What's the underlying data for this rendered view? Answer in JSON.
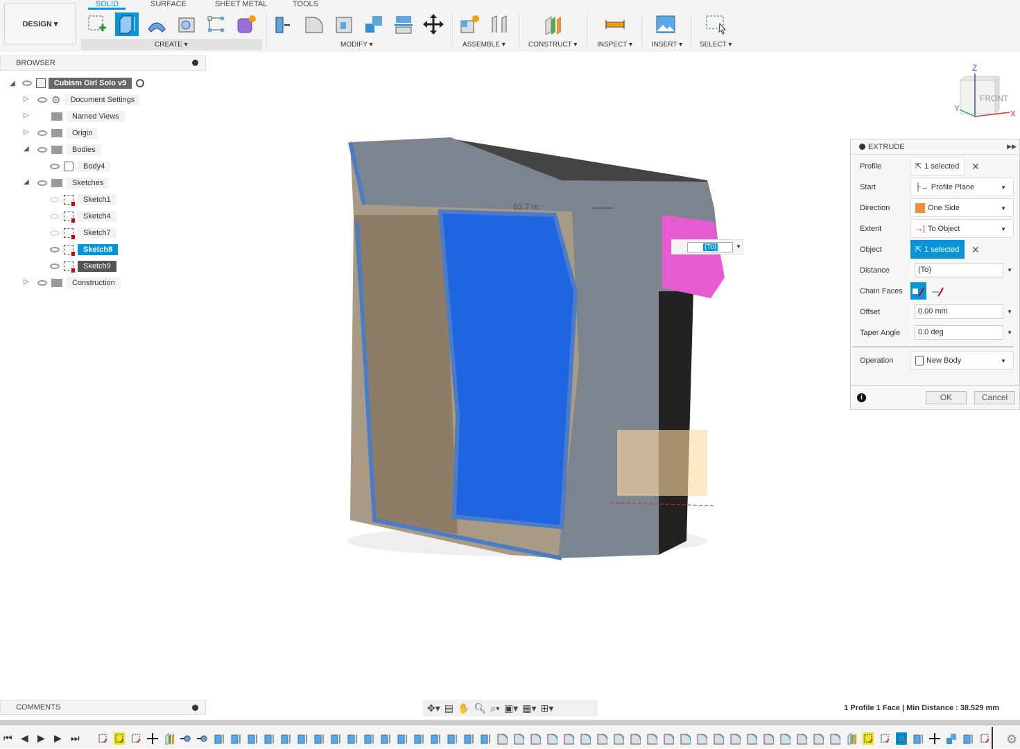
{
  "toolbar": {
    "workspace": "DESIGN ▾",
    "tabs": [
      "SOLID",
      "SURFACE",
      "SHEET METAL",
      "TOOLS"
    ],
    "groups": [
      "CREATE ▾",
      "MODIFY ▾",
      "ASSEMBLE ▾",
      "CONSTRUCT ▾",
      "INSPECT ▾",
      "INSERT ▾",
      "SELECT ▾"
    ],
    "create_icons": [
      "create-sketch-icon",
      "extrude-icon",
      "revolve-icon",
      "hole-icon",
      "pattern-icon",
      "create-form-icon"
    ],
    "modify_icons": [
      "press-pull-icon",
      "fillet-icon",
      "shell-icon",
      "combine-icon",
      "split-body-icon",
      "move-icon"
    ]
  },
  "browser": {
    "title": "BROWSER",
    "root": "Cubism Girl Solo v9",
    "items": [
      {
        "label": "Document Settings"
      },
      {
        "label": "Named Views"
      },
      {
        "label": "Origin"
      },
      {
        "label": "Bodies"
      },
      {
        "label": "Body4"
      },
      {
        "label": "Sketches"
      },
      {
        "label": "Sketch1"
      },
      {
        "label": "Sketch4"
      },
      {
        "label": "Sketch7"
      },
      {
        "label": "Sketch8"
      },
      {
        "label": "Sketch9"
      },
      {
        "label": "Construction"
      }
    ]
  },
  "viewcube": {
    "face": "FRONT",
    "axes": [
      "Z",
      "X",
      "Y"
    ]
  },
  "viewport": {
    "dimension_label": "63.7 m",
    "inline_input": "(To)"
  },
  "extrude": {
    "title": "EXTRUDE",
    "rows": [
      {
        "label": "Profile",
        "value": "1 selected"
      },
      {
        "label": "Start",
        "value": "Profile Plane"
      },
      {
        "label": "Direction",
        "value": "One Side"
      },
      {
        "label": "Extent",
        "value": "To Object"
      },
      {
        "label": "Object",
        "value": "1 selected"
      },
      {
        "label": "Distance",
        "value": "(To)"
      },
      {
        "label": "Chain Faces",
        "value": ""
      },
      {
        "label": "Offset",
        "value": "0.00 mm"
      },
      {
        "label": "Taper Angle",
        "value": "0.0 deg"
      },
      {
        "label": "Operation",
        "value": "New Body"
      }
    ],
    "ok": "OK",
    "cancel": "Cancel",
    "accent": "#0696d7"
  },
  "comments": {
    "title": "COMMENTS"
  },
  "status": "1 Profile 1 Face | Min Distance : 38.529 mm",
  "timeline": [
    "sketch",
    "sketch-yellow",
    "sketch",
    "move",
    "plane",
    "joint",
    "joint",
    "extrude",
    "extrude",
    "extrude",
    "extrude",
    "extrude",
    "extrude",
    "extrude",
    "extrude",
    "extrude",
    "extrude",
    "extrude",
    "extrude",
    "extrude",
    "extrude",
    "extrude",
    "extrude",
    "extrude",
    "fillet",
    "fillet",
    "fillet",
    "fillet",
    "fillet",
    "fillet",
    "fillet",
    "fillet",
    "fillet",
    "fillet",
    "fillet",
    "fillet",
    "fillet",
    "fillet",
    "fillet",
    "fillet",
    "fillet",
    "fillet",
    "fillet",
    "fillet",
    "fillet",
    "construct",
    "sketch-yellow",
    "sketch",
    "sketch-blue",
    "extrude",
    "move",
    "combine",
    "extrude",
    "sketch"
  ]
}
